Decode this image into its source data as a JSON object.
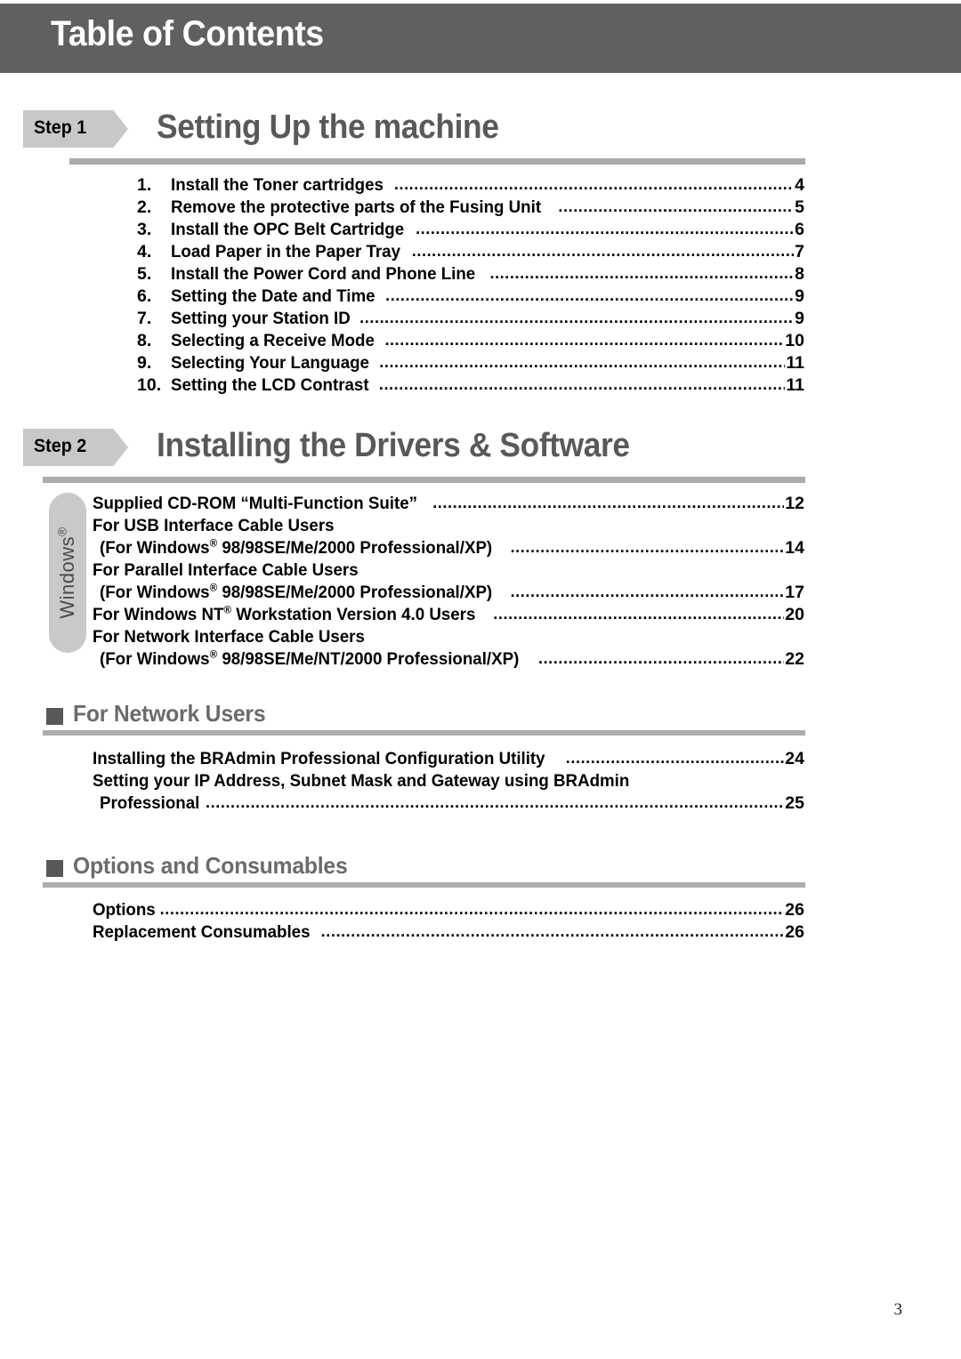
{
  "header": {
    "title": "Table of Contents"
  },
  "steps": [
    {
      "badge": "Step 1",
      "title": "Setting Up the machine",
      "entries": [
        {
          "num": "1.",
          "label": "Install the Toner cartridges",
          "page": "4"
        },
        {
          "num": "2.",
          "label": "Remove the protective parts of the Fusing Unit",
          "page": "5"
        },
        {
          "num": "3.",
          "label": "Install the OPC Belt Cartridge",
          "page": "6"
        },
        {
          "num": "4.",
          "label": "Load Paper in the Paper Tray",
          "page": "7"
        },
        {
          "num": "5.",
          "label": "Install the Power Cord and Phone Line",
          "page": "8"
        },
        {
          "num": "6.",
          "label": "Setting the Date and Time",
          "page": "9"
        },
        {
          "num": "7.",
          "label": "Setting your Station ID",
          "page": "9"
        },
        {
          "num": "8.",
          "label": "Selecting a Receive Mode",
          "page": "10"
        },
        {
          "num": "9.",
          "label": "Selecting Your Language",
          "page": "11"
        },
        {
          "num": "10.",
          "label": "Setting the LCD Contrast",
          "page": "11"
        }
      ]
    },
    {
      "badge": "Step 2",
      "title": "Installing the Drivers & Software",
      "side_tab": "Windows",
      "side_tab_mark": "®",
      "entries": [
        {
          "label": "Supplied CD-ROM “Multi-Function Suite”",
          "page": "12"
        },
        {
          "label": "For USB Interface Cable Users"
        },
        {
          "label_pre": "(For Windows",
          "label_mark": "®",
          "label_post": " 98/98SE/Me/2000 Professional/XP)",
          "page": "14",
          "indent": true
        },
        {
          "label": "For Parallel Interface Cable Users"
        },
        {
          "label_pre": "(For Windows",
          "label_mark": "®",
          "label_post": " 98/98SE/Me/2000 Professional/XP)",
          "page": "17",
          "indent": true
        },
        {
          "label_pre": "For Windows NT",
          "label_mark": "®",
          "label_post": " Workstation Version 4.0 Users",
          "page": "20"
        },
        {
          "label": "For Network Interface Cable Users"
        },
        {
          "label_pre": "(For Windows",
          "label_mark": "®",
          "label_post": " 98/98SE/Me/NT/2000 Professional/XP)",
          "page": "22",
          "indent": true
        }
      ]
    }
  ],
  "sections": [
    {
      "title": "For Network Users",
      "entries": [
        {
          "label": "Installing the BRAdmin Professional Configuration Utility",
          "page": "24"
        },
        {
          "label": "Setting your IP Address, Subnet Mask and Gateway using BRAdmin"
        },
        {
          "label": "Professional",
          "page": "25",
          "indent": true
        }
      ]
    },
    {
      "title": "Options and Consumables",
      "entries": [
        {
          "label": "Options",
          "page": "26"
        },
        {
          "label": "Replacement Consumables",
          "page": "26"
        }
      ]
    }
  ],
  "footer": {
    "page_number": "3"
  },
  "colors": {
    "header_bar": "#606060",
    "step_badge": "#c8c8c8",
    "step_title": "#595959",
    "rule": "#ababab",
    "section_bullet": "#585858",
    "section_title": "#6b6b6b",
    "side_tab": "#c9c9c9"
  }
}
